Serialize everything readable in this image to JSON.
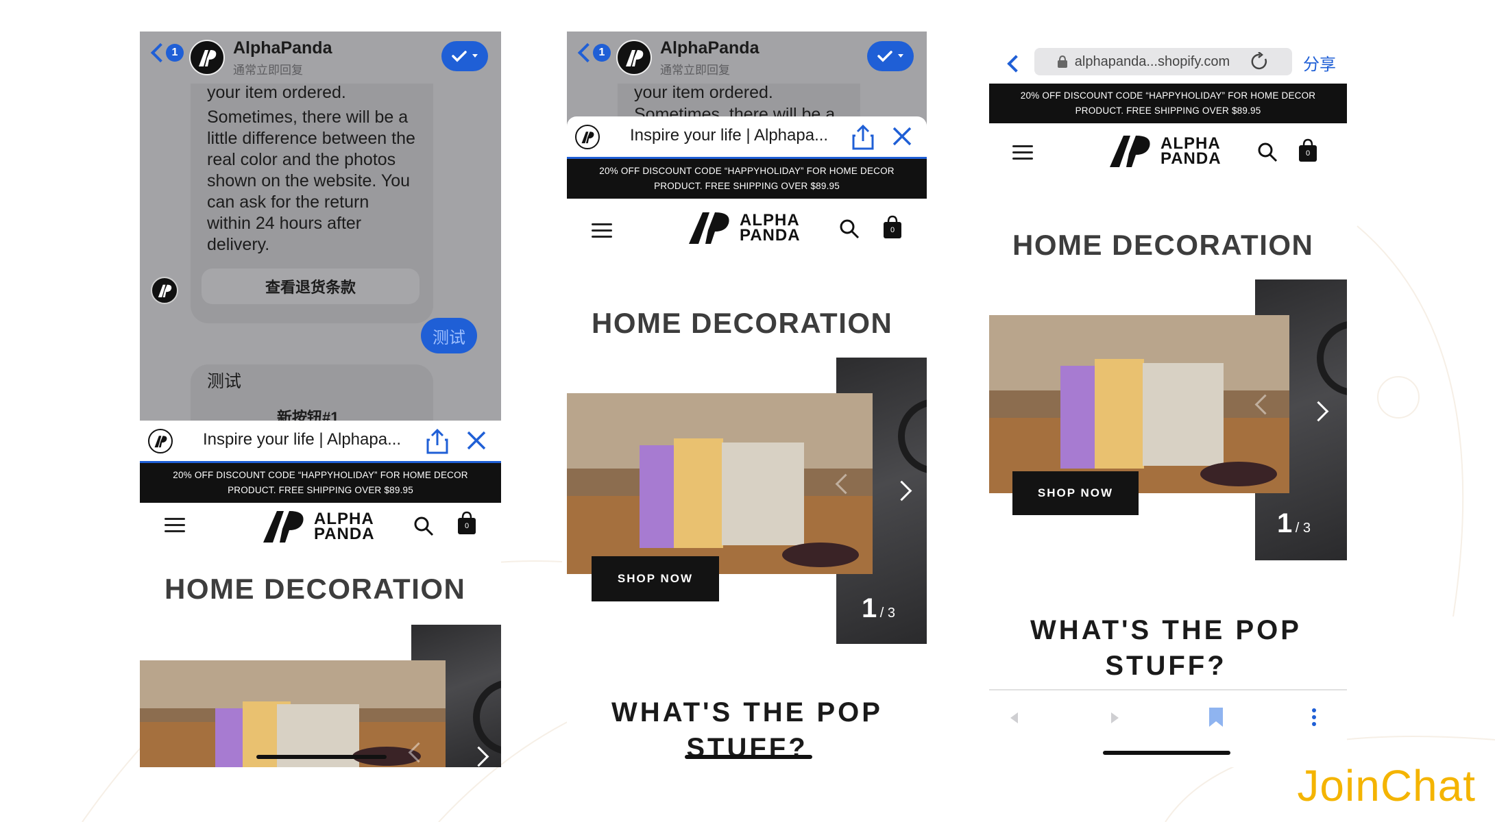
{
  "chat": {
    "back_badge": "1",
    "brand_name": "AlphaPanda",
    "brand_sub": "通常立即回复",
    "msg_partial": "your item ordered.",
    "msg_text": "Sometimes, there will be a little difference between the real color and the photos shown on the website. You can ask for the return within 24 hours after delivery.",
    "msg_text_cut": "Sometimes, there will be a",
    "return_button": "查看退货条款",
    "user_message": "测试",
    "bot_reply": "测试",
    "new_button": "新按钮#1"
  },
  "webview": {
    "title": "Inspire your life | Alphapa..."
  },
  "store": {
    "promo_line1": "20% OFF DISCOUNT CODE “HAPPYHOLIDAY” FOR HOME DECOR",
    "promo_line2": "PRODUCT. FREE SHIPPING OVER $89.95",
    "logo_line1": "ALPHA",
    "logo_line2": "PANDA",
    "cart_count": "0",
    "section_title": "HOME DECORATION",
    "shop_now": "SHOP NOW",
    "slide_current": "1",
    "slide_total": "/ 3",
    "pop_line1": "WHAT'S THE POP",
    "pop_line2": "STUFF?"
  },
  "browser": {
    "url": "alphapanda...shopify.com",
    "share": "分享"
  },
  "branding": {
    "joinchat": "JoinChat"
  },
  "colors": {
    "accent_blue": "#1f5fd6",
    "chat_gray": "#a3a3a6",
    "promo_bg": "#111111",
    "joinchat_yellow": "#f4b400"
  },
  "icons": [
    "back-chevron-icon",
    "check-icon",
    "share-icon",
    "close-icon",
    "menu-icon",
    "search-icon",
    "bag-icon",
    "lock-icon",
    "reload-icon",
    "bookmark-icon",
    "more-icon"
  ]
}
